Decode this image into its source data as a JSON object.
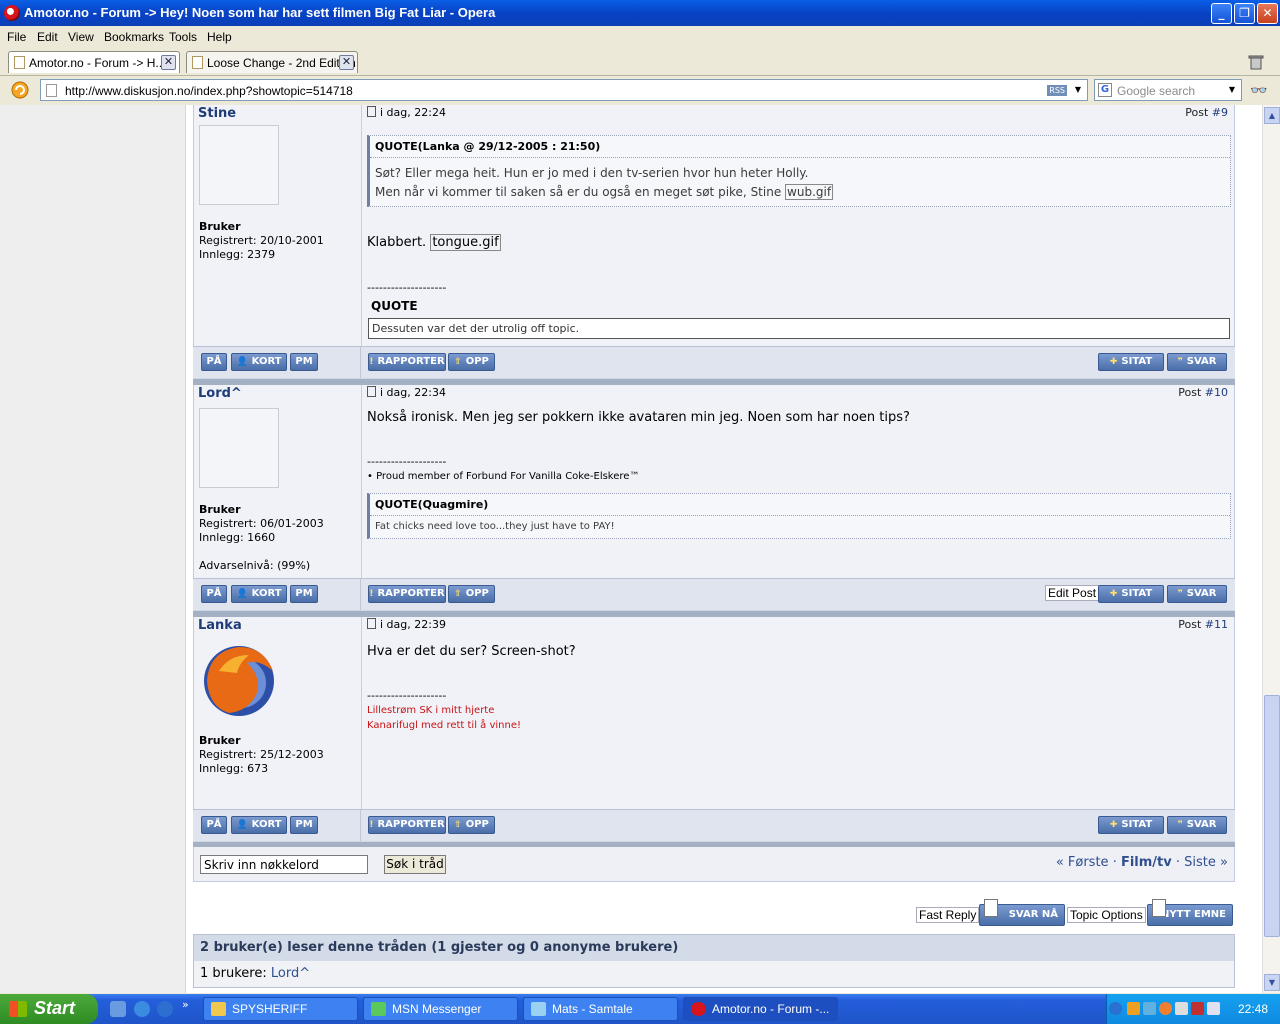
{
  "window": {
    "title": "Amotor.no - Forum -> Hey! Noen som har har sett filmen Big Fat Liar - Opera"
  },
  "menu": [
    "File",
    "Edit",
    "View",
    "Bookmarks",
    "Tools",
    "Help"
  ],
  "tabs": [
    {
      "label": "Amotor.no - Forum -> H..."
    },
    {
      "label": "Loose Change - 2nd Edition"
    }
  ],
  "address": {
    "url": "http://www.diskusjon.no/index.php?showtopic=514718",
    "rss": "RSS"
  },
  "search": {
    "placeholder": "Google search"
  },
  "posts": [
    {
      "author": "Stine",
      "date": "i dag, 22:24",
      "post_label": "Post ",
      "post_no": "#9",
      "role": "Bruker",
      "registered": "Registrert: 20/10-2001",
      "posts_count": "Innlegg: 2379",
      "quote_header": "QUOTE(Lanka @ 29/12-2005 : 21:50)",
      "quote_line1": "Søt? Eller mega heit. Hun er jo med i den tv-serien hvor hun heter Holly.",
      "quote_line2": "Men når vi kommer til saken så er du også en meget søt pike, Stine ",
      "quote_img": "wub.gif",
      "text": "Klabbert. ",
      "text_img": "tongue.gif",
      "sig_sep": "--------------------",
      "sig_quote_label": "QUOTE",
      "sig_quote_text": "Dessuten var det der utrolig off topic."
    },
    {
      "author": "Lord^",
      "date": "i dag, 22:34",
      "post_label": "Post ",
      "post_no": "#10",
      "role": "Bruker",
      "registered": "Registrert: 06/01-2003",
      "posts_count": "Innlegg: 1660",
      "warning": "Advarselnivå: (99%)",
      "text": "Nokså ironisk. Men jeg ser pokkern ikke avataren min jeg. Noen som har noen tips?",
      "sig_sep": "--------------------",
      "sig_line": "• Proud member of Forbund For Vanilla Coke-Elskere™",
      "quote_header": "QUOTE(Quagmire)",
      "quote_text": "Fat chicks need love too...they just have to PAY!"
    },
    {
      "author": "Lanka",
      "date": "i dag, 22:39",
      "post_label": "Post ",
      "post_no": "#11",
      "role": "Bruker",
      "registered": "Registrert: 25/12-2003",
      "posts_count": "Innlegg: 673",
      "text": "Hva er det du ser? Screen-shot?",
      "sig_sep": "--------------------",
      "sig_line1": "Lillestrøm SK i mitt hjerte",
      "sig_line2": "Kanarifugl med rett til å vinne!"
    }
  ],
  "buttons": {
    "pa": "PÅ",
    "kort": "KORT",
    "pm": "PM",
    "rapporter": "RAPPORTER",
    "opp": "OPP",
    "sitat": "SITAT",
    "svar": "SVAR",
    "edit_post": "Edit Post"
  },
  "topic_search": {
    "placeholder_value": "Skriv inn nøkkelord",
    "button": "Søk i tråd"
  },
  "pager": {
    "first": "« Første",
    "dot": "·",
    "current": "Film/tv",
    "last": "Siste »"
  },
  "fast": {
    "fast_reply": "Fast Reply",
    "svar_na": "SVAR NÅ",
    "topic_options": "Topic Options",
    "nytt_emne": "NYTT EMNE"
  },
  "online": {
    "header": "2 bruker(e) leser denne tråden (1 gjester og 0 anonyme brukere)",
    "label": "1 brukere: ",
    "user": "Lord^"
  },
  "taskbar": {
    "start": "Start",
    "tasks": [
      "SPYSHERIFF",
      "MSN Messenger",
      "Mats - Samtale",
      "Amotor.no - Forum -..."
    ],
    "clock": "22:48"
  }
}
